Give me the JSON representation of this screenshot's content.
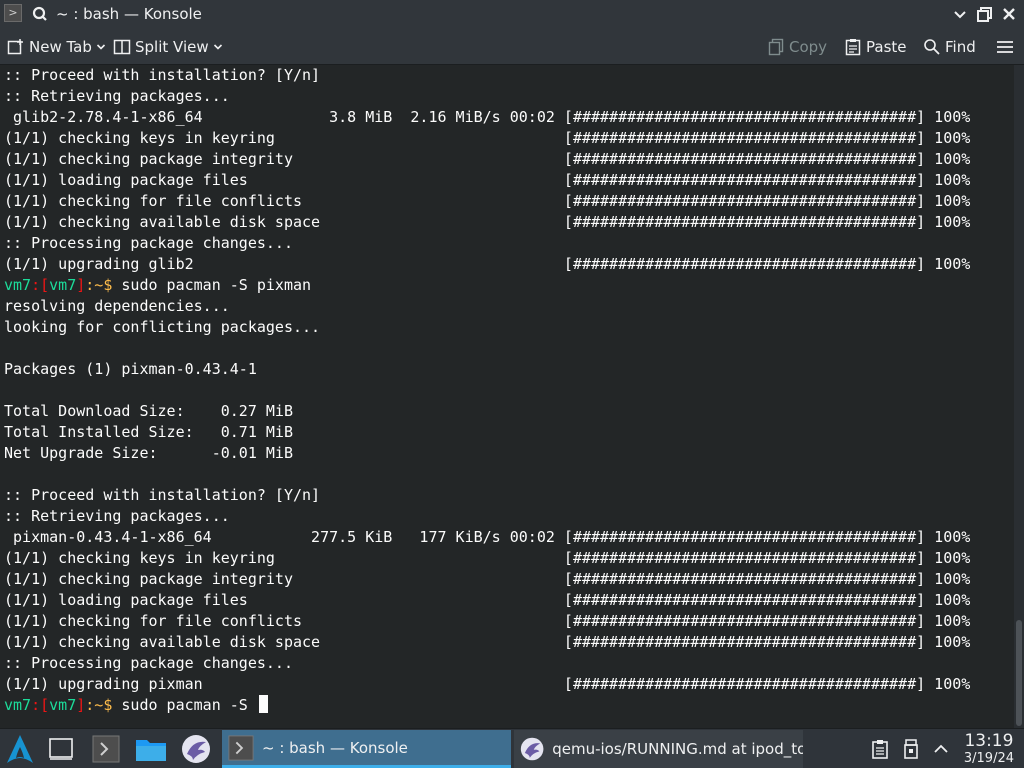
{
  "window": {
    "title": "~ : bash — Konsole",
    "app_icon": "terminal-icon",
    "controls": [
      "minimize-icon",
      "maximize-icon",
      "close-icon"
    ]
  },
  "toolbar": {
    "new_tab": "New Tab",
    "split_view": "Split View",
    "copy": "Copy",
    "paste": "Paste",
    "find": "Find",
    "menu_icon": "hamburger-menu-icon"
  },
  "terminal": {
    "lines": [
      ":: Proceed with installation? [Y/n]",
      ":: Retrieving packages...",
      " glib2-2.78.4-1-x86_64              3.8 MiB  2.16 MiB/s 00:02 [######################################] 100%",
      "(1/1) checking keys in keyring                                [######################################] 100%",
      "(1/1) checking package integrity                              [######################################] 100%",
      "(1/1) loading package files                                   [######################################] 100%",
      "(1/1) checking for file conflicts                             [######################################] 100%",
      "(1/1) checking available disk space                           [######################################] 100%",
      ":: Processing package changes...",
      "(1/1) upgrading glib2                                         [######################################] 100%"
    ],
    "prompt1": {
      "host": "vm7",
      "sep1": ":",
      "br_open": "[",
      "user": "vm7",
      "br_close": "]",
      "path": ":~$",
      "command": " sudo pacman -S pixman"
    },
    "lines2": [
      "resolving dependencies...",
      "looking for conflicting packages...",
      "",
      "Packages (1) pixman-0.43.4-1",
      "",
      "Total Download Size:    0.27 MiB",
      "Total Installed Size:   0.71 MiB",
      "Net Upgrade Size:      -0.01 MiB",
      "",
      ":: Proceed with installation? [Y/n]",
      ":: Retrieving packages...",
      " pixman-0.43.4-1-x86_64           277.5 KiB   177 KiB/s 00:02 [######################################] 100%",
      "(1/1) checking keys in keyring                                [######################################] 100%",
      "(1/1) checking package integrity                              [######################################] 100%",
      "(1/1) loading package files                                   [######################################] 100%",
      "(1/1) checking for file conflicts                             [######################################] 100%",
      "(1/1) checking available disk space                           [######################################] 100%",
      ":: Processing package changes...",
      "(1/1) upgrading pixman                                        [######################################] 100%"
    ],
    "prompt2": {
      "host": "vm7",
      "sep1": ":",
      "br_open": "[",
      "user": "vm7",
      "br_close": "]",
      "path": ":~$",
      "command": " sudo pacman -S "
    }
  },
  "taskbar": {
    "launcher_icon": "arch-launcher-icon",
    "tasks": [
      {
        "label": "~ : bash — Konsole",
        "icon": "terminal-icon",
        "active": true
      },
      {
        "label": "qemu-ios/RUNNING.md at ipod_to…",
        "icon": "falkon-browser-icon",
        "active": false
      }
    ],
    "tray": [
      "clipboard-icon",
      "usb-device-icon",
      "chevron-up-icon"
    ],
    "clock": {
      "time": "13:19",
      "date": "3/19/24"
    }
  }
}
